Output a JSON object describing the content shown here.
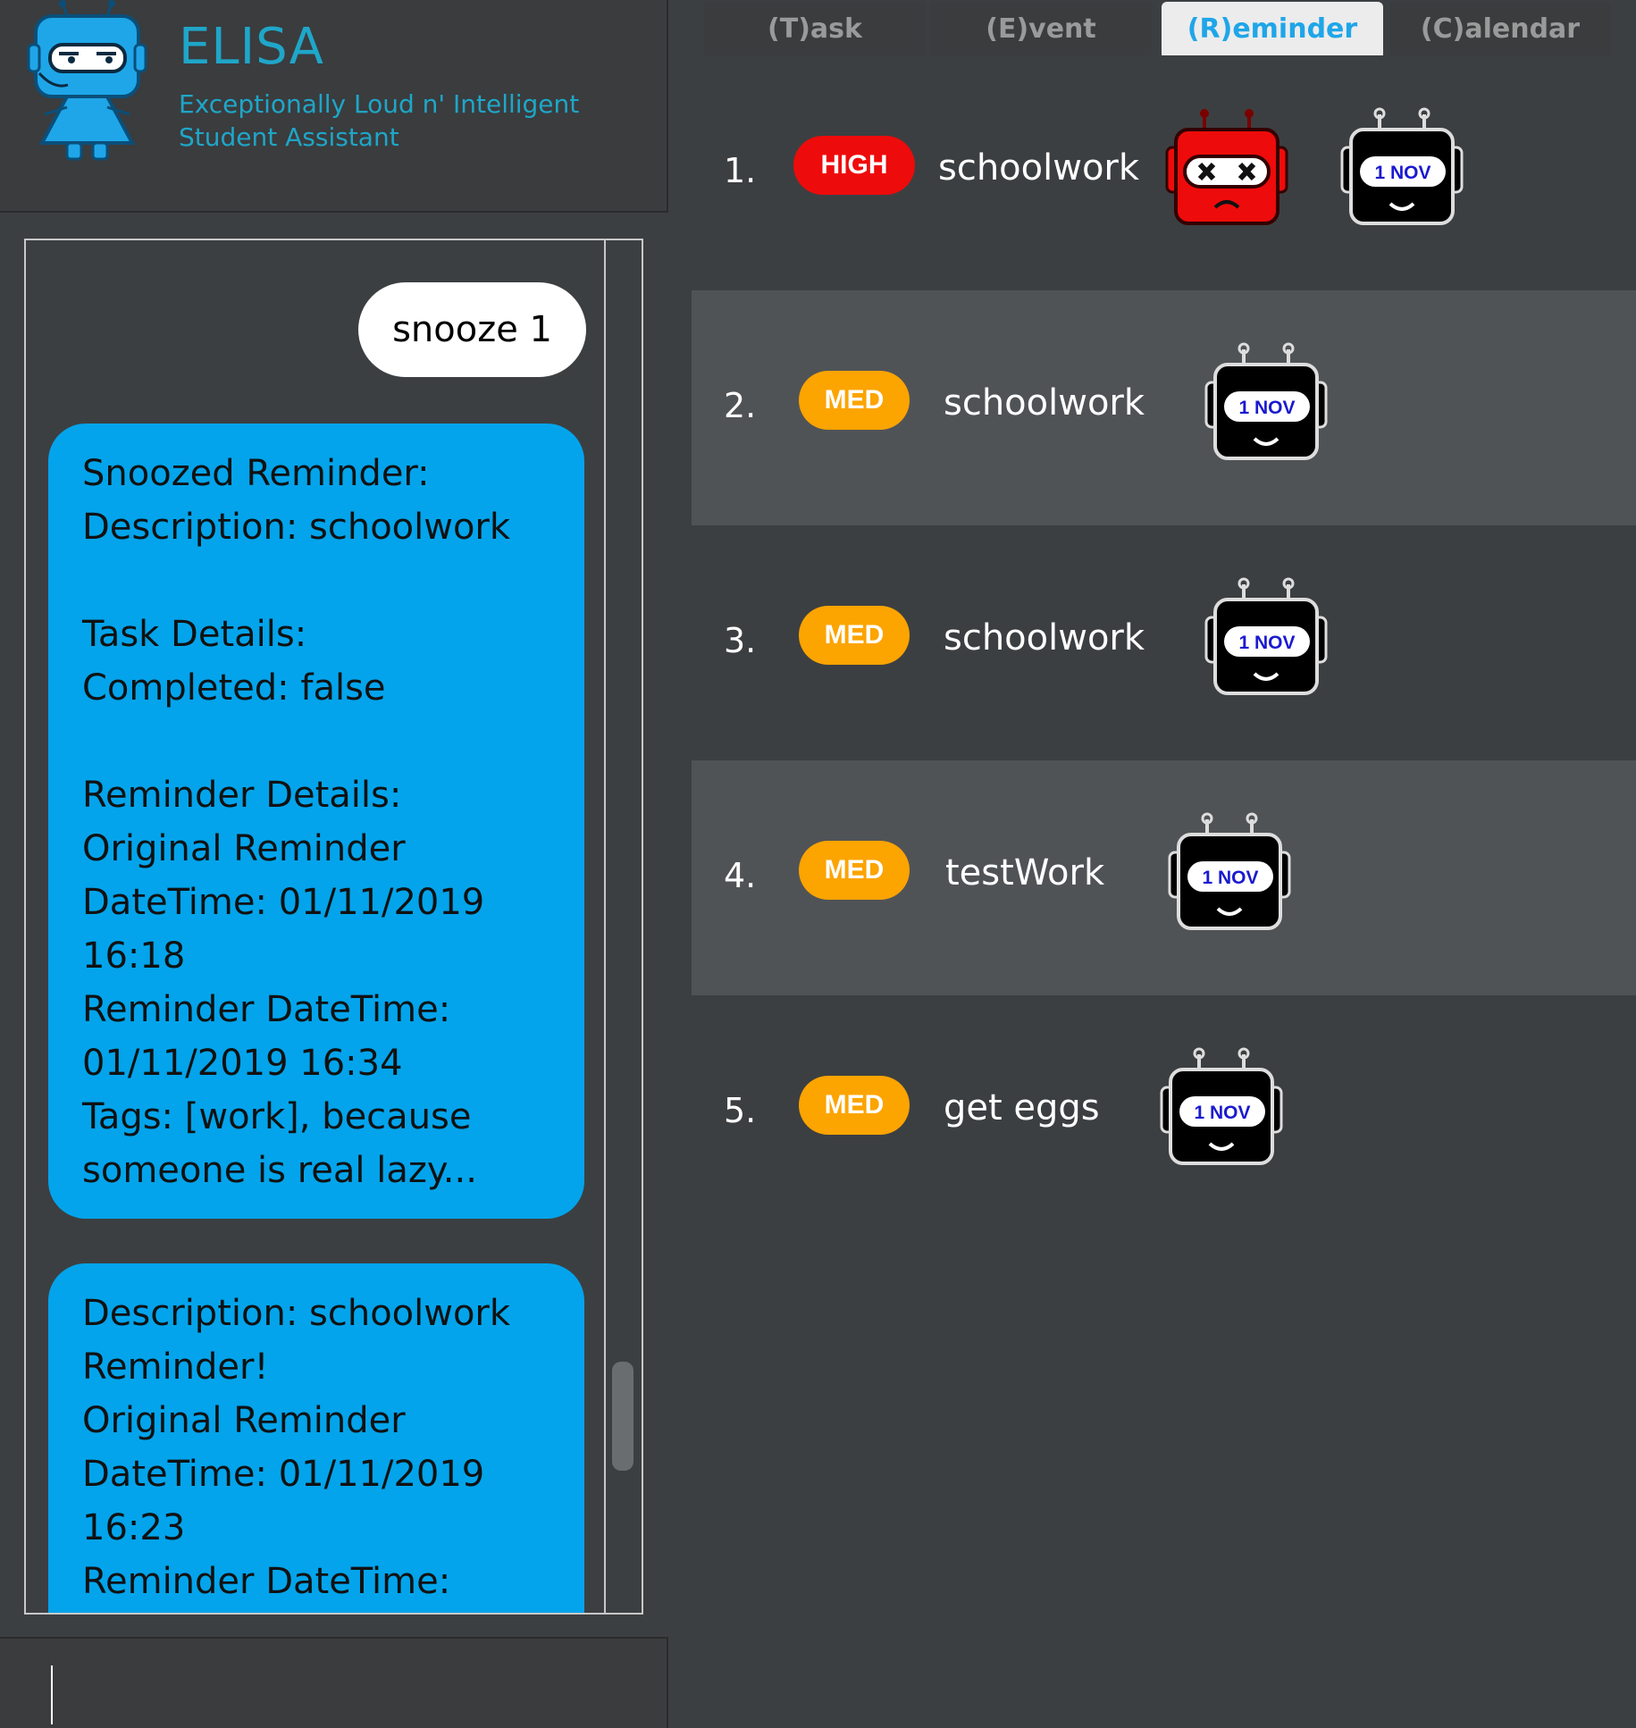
{
  "app": {
    "title": "ELISA",
    "subtitle_line1": "Exceptionally Loud n' Intelligent",
    "subtitle_line2": "Student Assistant"
  },
  "chat": {
    "user_message": "snooze 1",
    "bot_message_1": "Snoozed Reminder:\nDescription: schoolwork\n\nTask Details:\nCompleted: false\n\nReminder Details:\nOriginal Reminder\nDateTime: 01/11/2019\n16:18\nReminder DateTime:\n01/11/2019 16:34\nTags: [work], because\nsomeone is real lazy...",
    "bot_message_2": "Description: schoolwork\nReminder!\nOriginal Reminder\nDateTime: 01/11/2019\n16:23\nReminder DateTime:"
  },
  "input": {
    "value": "",
    "placeholder": ""
  },
  "tabs": [
    {
      "label": "(T)ask",
      "active": false
    },
    {
      "label": "(E)vent",
      "active": false
    },
    {
      "label": "(R)eminder",
      "active": true
    },
    {
      "label": "(C)alendar",
      "active": false
    }
  ],
  "reminders": [
    {
      "index": "1.",
      "priority": "HIGH",
      "description": "schoolwork",
      "date_badge": "1 NOV",
      "status_icon": "angry-robot-icon"
    },
    {
      "index": "2.",
      "priority": "MED",
      "description": "schoolwork",
      "date_badge": "1 NOV"
    },
    {
      "index": "3.",
      "priority": "MED",
      "description": "schoolwork",
      "date_badge": "1 NOV"
    },
    {
      "index": "4.",
      "priority": "MED",
      "description": "testWork",
      "date_badge": "1 NOV"
    },
    {
      "index": "5.",
      "priority": "MED",
      "description": "get eggs",
      "date_badge": "1 NOV"
    }
  ],
  "colors": {
    "accent": "#1fa6c8",
    "bubble_bot": "#03a4eb",
    "priority_high": "#ee0b0b",
    "priority_med": "#fca400",
    "background": "#3c3f41"
  }
}
